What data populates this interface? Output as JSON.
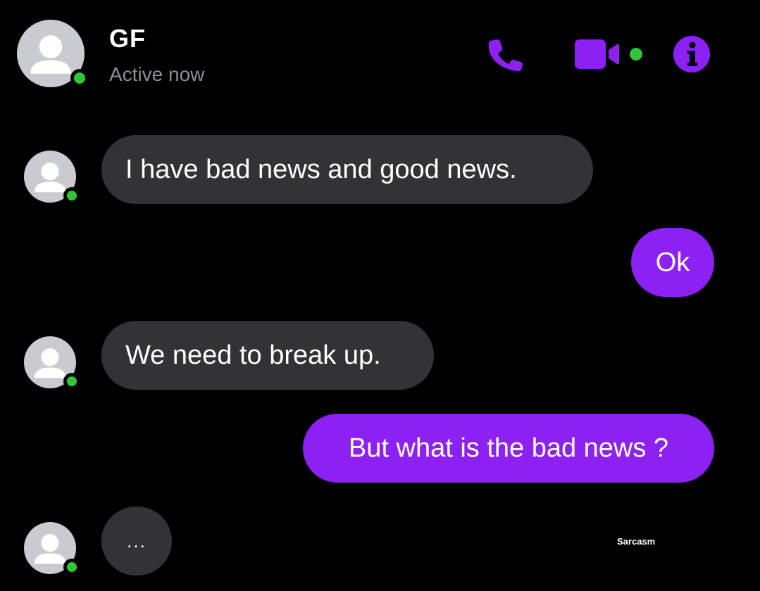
{
  "header": {
    "contact_name": "GF",
    "status": "Active now",
    "icons": [
      "phone-icon",
      "video-camera-icon",
      "info-icon"
    ],
    "online_indicator_color": "#31c53a"
  },
  "colors": {
    "background": "#000000",
    "incoming_bubble": "#333335",
    "outgoing_bubble": "#8d20f2",
    "accent": "#8d20f2"
  },
  "messages": [
    {
      "direction": "incoming",
      "text": "I have bad news and good news."
    },
    {
      "direction": "outgoing",
      "text": "Ok"
    },
    {
      "direction": "incoming",
      "text": "We need to break up."
    },
    {
      "direction": "outgoing",
      "text": "But what is the bad news ?"
    },
    {
      "direction": "incoming",
      "text": "..."
    }
  ],
  "watermark": "Sarcasm"
}
